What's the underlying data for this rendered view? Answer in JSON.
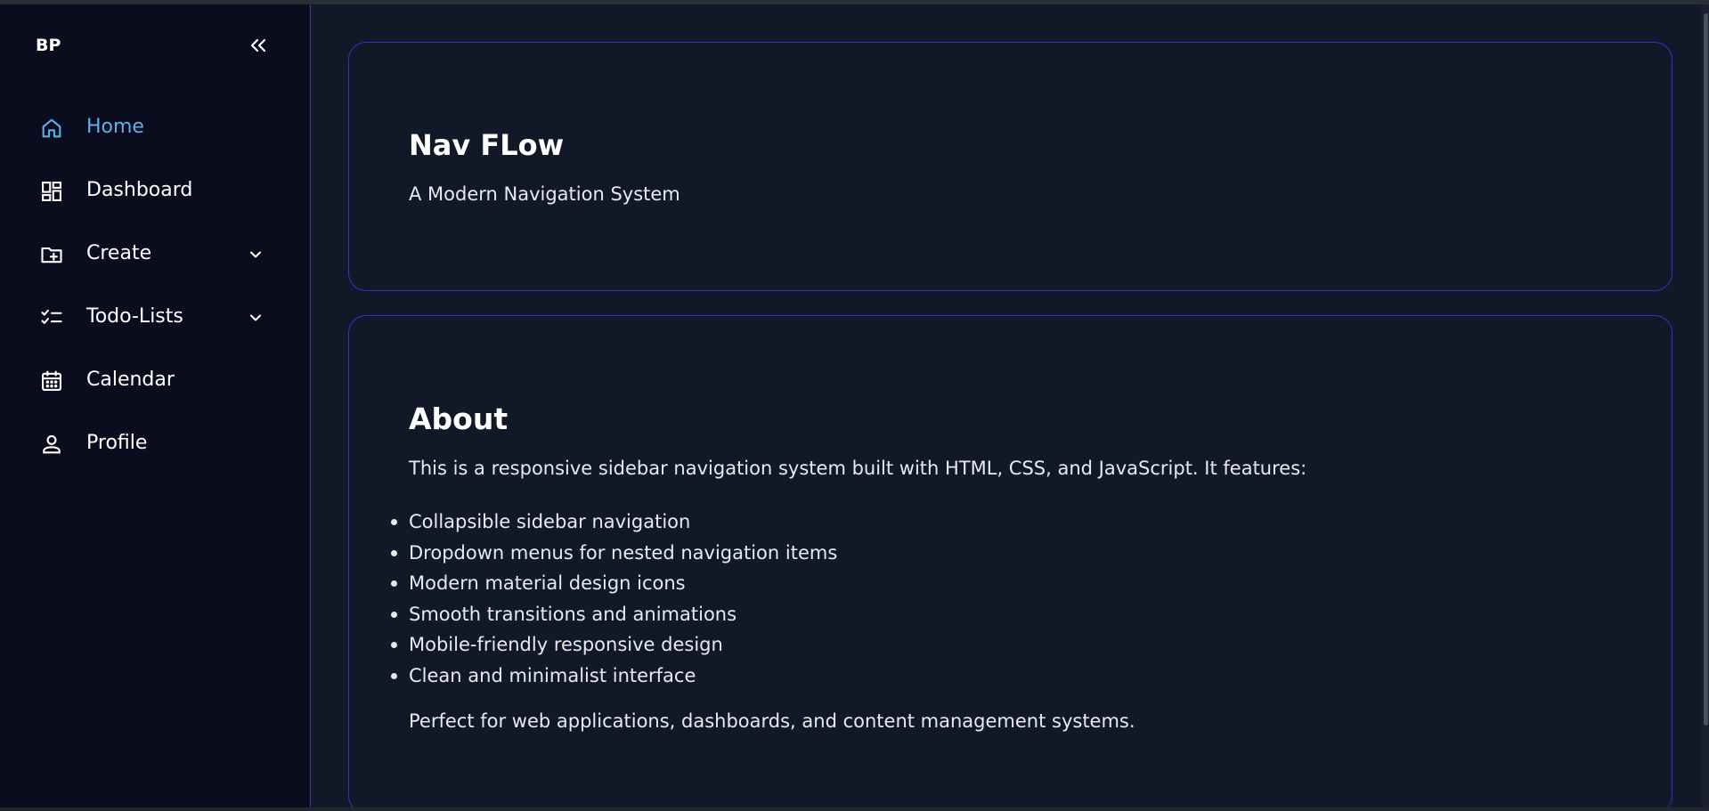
{
  "app": {
    "logo": "BP"
  },
  "sidebar": {
    "collapse_icon": "double-chevron-left-icon",
    "items": [
      {
        "label": "Home",
        "icon": "home-icon",
        "active": true,
        "has_dropdown": false
      },
      {
        "label": "Dashboard",
        "icon": "dashboard-icon",
        "active": false,
        "has_dropdown": false
      },
      {
        "label": "Create",
        "icon": "create-folder-icon",
        "active": false,
        "has_dropdown": true
      },
      {
        "label": "Todo-Lists",
        "icon": "checklist-icon",
        "active": false,
        "has_dropdown": true
      },
      {
        "label": "Calendar",
        "icon": "calendar-icon",
        "active": false,
        "has_dropdown": false
      },
      {
        "label": "Profile",
        "icon": "person-icon",
        "active": false,
        "has_dropdown": false
      }
    ]
  },
  "main": {
    "hero": {
      "title": "Nav FLow",
      "subtitle": "A Modern Navigation System"
    },
    "about": {
      "title": "About",
      "intro": "This is a responsive sidebar navigation system built with HTML, CSS, and JavaScript. It features:",
      "features": [
        "Collapsible sidebar navigation",
        "Dropdown menus for nested navigation items",
        "Modern material design icons",
        "Smooth transitions and animations",
        "Mobile-friendly responsive design",
        "Clean and minimalist interface"
      ],
      "outro": "Perfect for web applications, dashboards, and content management systems."
    }
  },
  "colors": {
    "background": "#111827",
    "sidebar": "#0b0d1e",
    "accent": "#5cb1e8",
    "card_border": "#3a2fc2"
  }
}
